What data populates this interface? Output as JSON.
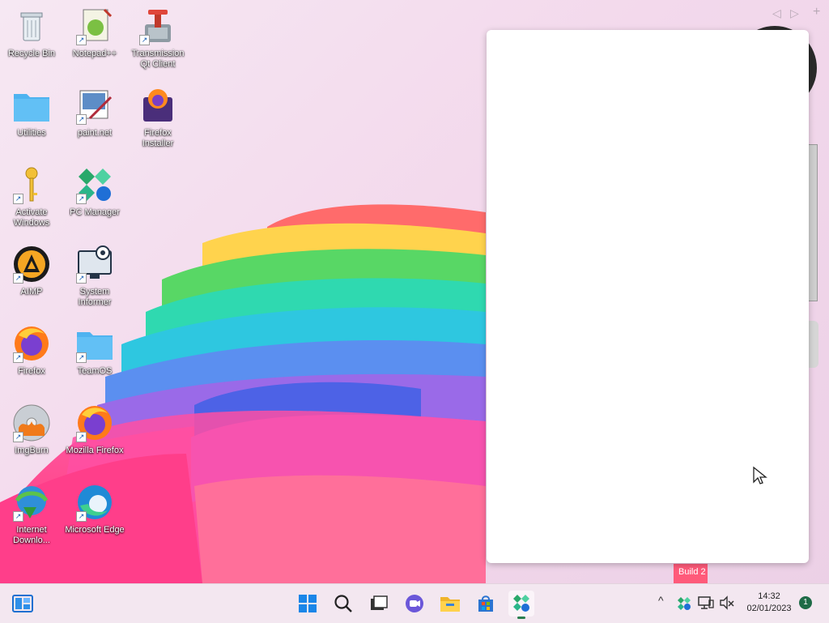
{
  "desktop": {
    "icons": [
      {
        "label": "Recycle Bin"
      },
      {
        "label": "Notepad++"
      },
      {
        "label": "Transmission Qt Client"
      },
      {
        "label": "Utilities"
      },
      {
        "label": "paint.net"
      },
      {
        "label": "Firefox Installer"
      },
      {
        "label": "Activate Windows"
      },
      {
        "label": "PC Manager"
      },
      {
        "label": "AIMP"
      },
      {
        "label": "System Informer"
      },
      {
        "label": "Firefox"
      },
      {
        "label": "TeamOS"
      },
      {
        "label": "ImgBurn"
      },
      {
        "label": "Mozilla Firefox"
      },
      {
        "label": "Internet Downlo..."
      },
      {
        "label": "Microsoft Edge"
      }
    ],
    "watermark": "Build 2"
  },
  "top_nav": {
    "prev": "◁",
    "next": "▷",
    "add": "+"
  },
  "taskbar": {
    "apps": [
      {
        "icon": "start-icon"
      },
      {
        "icon": "search-icon"
      },
      {
        "icon": "task-view-icon"
      },
      {
        "icon": "chat-icon"
      },
      {
        "icon": "file-explorer-icon"
      },
      {
        "icon": "microsoft-store-icon"
      },
      {
        "icon": "pc-manager-icon"
      }
    ],
    "tray": {
      "chevron": "^",
      "clock_time": "14:32",
      "clock_date": "02/01/2023",
      "notification_count": "1"
    }
  },
  "colors": {
    "accent": "#2a7f4f",
    "taskbar_bg": "#f3e7f0"
  }
}
